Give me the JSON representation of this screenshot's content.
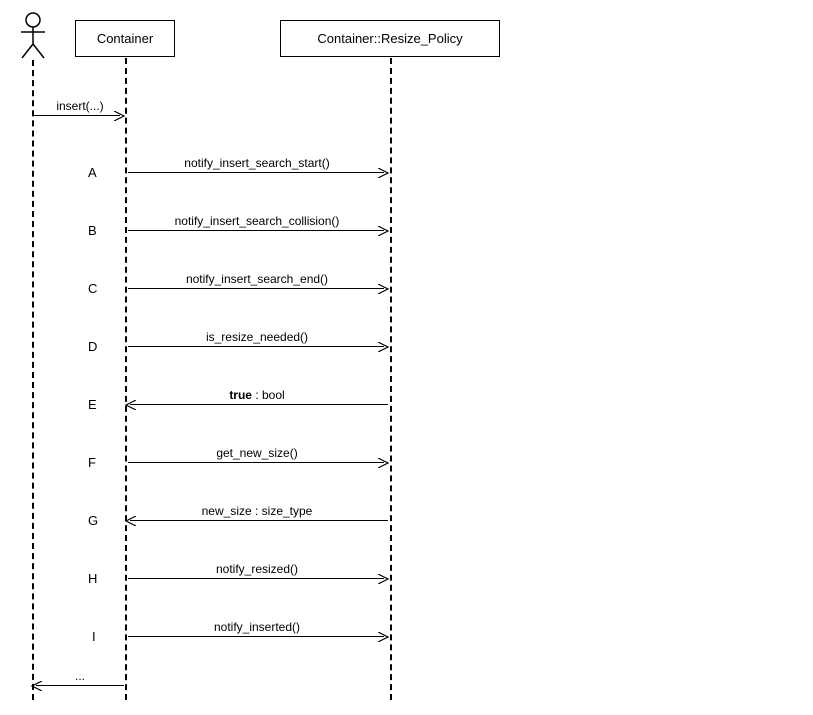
{
  "participants": {
    "actor": "Actor",
    "container": "Container",
    "resize_policy": "Container::Resize_Policy"
  },
  "initial_call": {
    "label": "insert(...)"
  },
  "return": {
    "label": "..."
  },
  "messages": [
    {
      "step": "A",
      "label": "notify_insert_search_start()",
      "dir": "right",
      "bold": false
    },
    {
      "step": "B",
      "label": "notify_insert_search_collision()",
      "dir": "right",
      "bold": false
    },
    {
      "step": "C",
      "label": "notify_insert_search_end()",
      "dir": "right",
      "bold": false
    },
    {
      "step": "D",
      "label": "is_resize_needed()",
      "dir": "right",
      "bold": false
    },
    {
      "step": "E",
      "label_bold": "true",
      "label_rest": " : bool",
      "dir": "left",
      "bold": true
    },
    {
      "step": "F",
      "label": "get_new_size()",
      "dir": "right",
      "bold": false
    },
    {
      "step": "G",
      "label": "new_size : size_type",
      "dir": "left",
      "bold": false
    },
    {
      "step": "H",
      "label": "notify_resized()",
      "dir": "right",
      "bold": false
    },
    {
      "step": "I",
      "label": "notify_inserted()",
      "dir": "right",
      "bold": false
    }
  ]
}
